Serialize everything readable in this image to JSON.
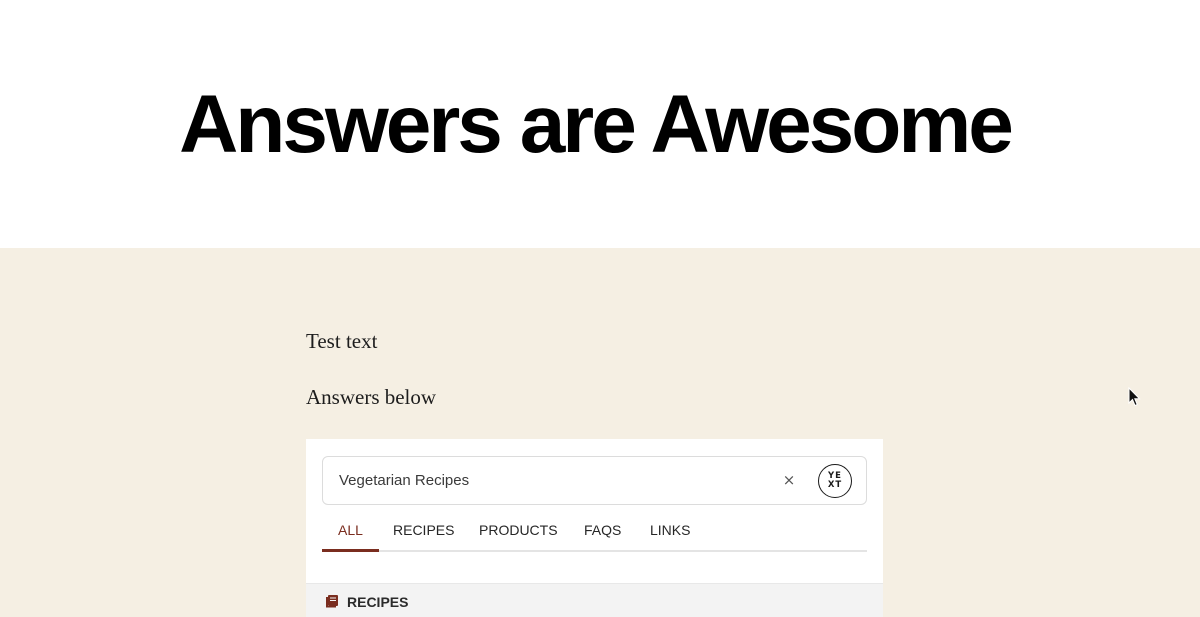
{
  "hero": {
    "title": "Answers are Awesome"
  },
  "content": {
    "line1": "Test text",
    "line2": "Answers below"
  },
  "answers": {
    "search": {
      "value": "Vegetarian Recipes",
      "clear_label": "×"
    },
    "logo_text": {
      "top": "YE",
      "bottom": "XT"
    },
    "tabs": [
      {
        "label": "ALL",
        "active": true
      },
      {
        "label": "RECIPES",
        "active": false
      },
      {
        "label": "PRODUCTS",
        "active": false
      },
      {
        "label": "FAQS",
        "active": false
      },
      {
        "label": "LINKS",
        "active": false
      }
    ],
    "section_header": {
      "icon": "book-icon",
      "label": "RECIPES"
    }
  },
  "colors": {
    "section_bg": "#f5efe3",
    "accent": "#7a2d1f"
  }
}
